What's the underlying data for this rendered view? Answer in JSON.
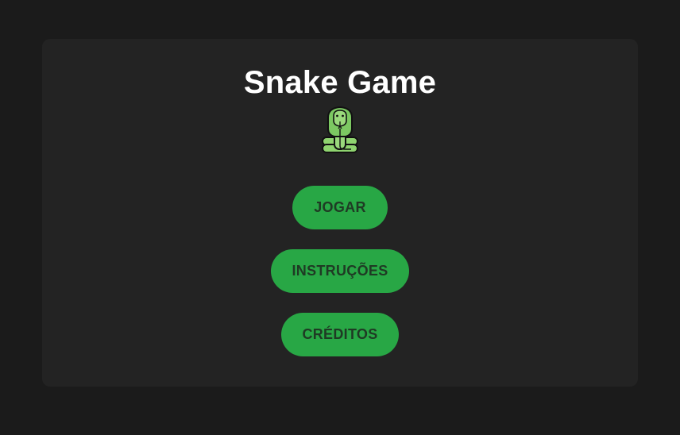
{
  "game": {
    "title": "Snake Game",
    "logo_icon": "snake-icon"
  },
  "menu": {
    "buttons": [
      {
        "label": "JOGAR"
      },
      {
        "label": "INSTRUÇÕES"
      },
      {
        "label": "CRÉDITOS"
      }
    ]
  },
  "colors": {
    "background": "#1b1b1b",
    "card": "#232323",
    "button": "#28a745",
    "button_text": "#1f3a24",
    "snake": "#7cc862"
  }
}
